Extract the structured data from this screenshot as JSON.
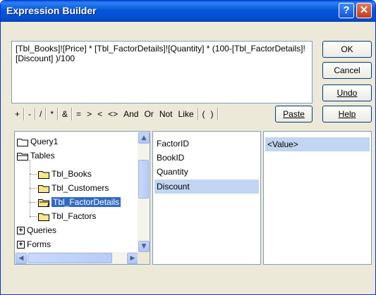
{
  "window": {
    "title": "Expression Builder"
  },
  "title_buttons": {
    "help": "?",
    "close": "✕"
  },
  "expression": {
    "text": "[Tbl_Books]![Price] * [Tbl_FactorDetails]![Quantity] * (100-[Tbl_FactorDetails]![Discount] )/100"
  },
  "buttons": {
    "ok": "OK",
    "cancel": "Cancel",
    "undo": "Undo",
    "paste": "Paste",
    "help": "Help"
  },
  "operators": [
    "+",
    "-",
    "/",
    "*",
    "&",
    "=",
    ">",
    "<",
    "<>",
    "And",
    "Or",
    "Not",
    "Like",
    "(",
    ")"
  ],
  "tree": {
    "items": [
      {
        "label": "Query1",
        "icon": "folder-icon"
      },
      {
        "label": "Tables",
        "icon": "folder-open-icon"
      },
      {
        "label": "Tbl_Books",
        "icon": "folder-icon"
      },
      {
        "label": "Tbl_Customers",
        "icon": "folder-icon"
      },
      {
        "label": "Tbl_FactorDetails",
        "icon": "folder-open-icon",
        "selected": true
      },
      {
        "label": "Tbl_Factors",
        "icon": "folder-icon"
      },
      {
        "label": "Queries",
        "icon": "plus-box-icon"
      },
      {
        "label": "Forms",
        "icon": "plus-box-icon"
      }
    ]
  },
  "fields": {
    "items": [
      "FactorID",
      "BookID",
      "Quantity",
      "Discount"
    ],
    "selected": "Discount"
  },
  "values": {
    "items": [
      "<Value>"
    ]
  },
  "colors": {
    "title_bar": "#0756d9",
    "selection": "#316ac5",
    "list_selection": "#c2d5f2",
    "dialog_bg": "#ece9d8"
  }
}
